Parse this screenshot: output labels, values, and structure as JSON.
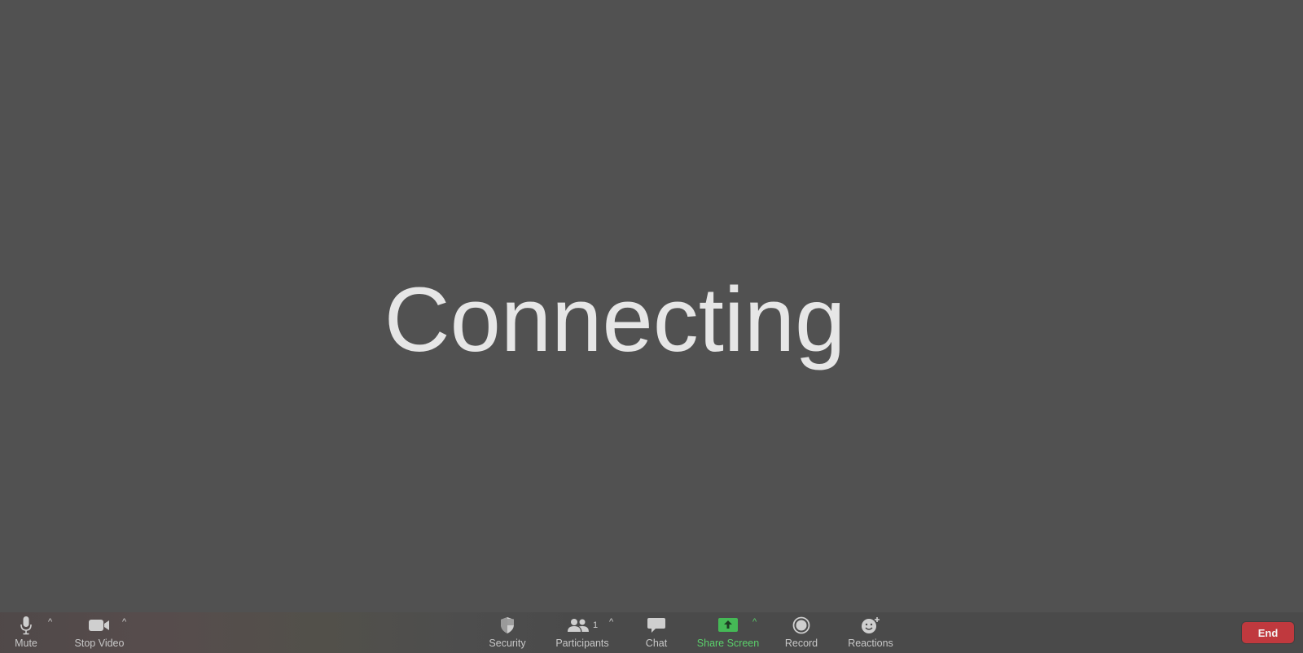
{
  "main": {
    "status_text": "Connecting"
  },
  "toolbar": {
    "mute_label": "Mute",
    "stop_video_label": "Stop Video",
    "security_label": "Security",
    "participants_label": "Participants",
    "participants_count": "1",
    "chat_label": "Chat",
    "share_screen_label": "Share Screen",
    "record_label": "Record",
    "reactions_label": "Reactions",
    "end_label": "End",
    "caret_glyph": "^"
  },
  "colors": {
    "stage_background": "#515151",
    "toolbar_background": "#4a4a4a",
    "share_accent": "#5bd06b",
    "end_button": "#c0393e"
  },
  "icons": {
    "mute": "microphone-icon",
    "stop_video": "video-camera-icon",
    "security": "shield-icon",
    "participants": "people-icon",
    "chat": "chat-bubble-icon",
    "share_screen": "share-screen-icon",
    "record": "record-icon",
    "reactions": "smiley-plus-icon"
  }
}
